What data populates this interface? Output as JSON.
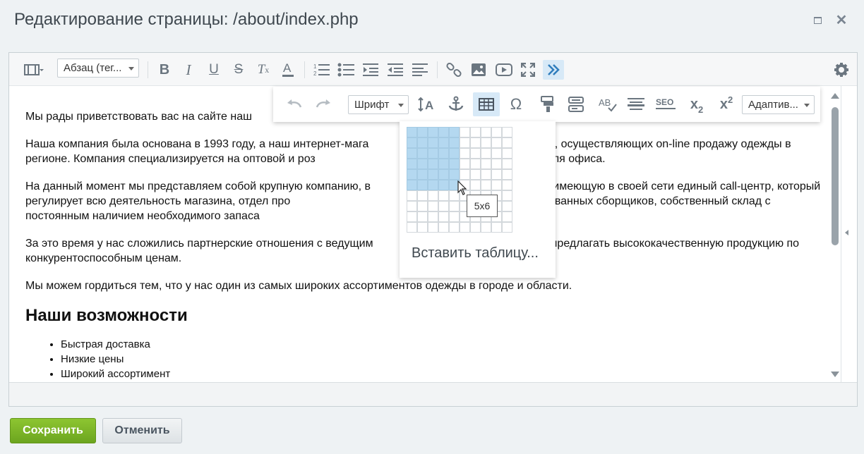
{
  "window": {
    "title": "Редактирование страницы: /about/index.php"
  },
  "toolbar": {
    "paragraph_select": "Абзац (тег...",
    "font_select": "Шрифт",
    "adaptive_select": "Адаптив..."
  },
  "table_picker": {
    "tooltip": "5x6",
    "insert_label": "Вставить таблицу...",
    "selected_cols": 5,
    "selected_rows": 6,
    "grid_cols": 10,
    "grid_rows": 10
  },
  "content": {
    "p1": "Мы рады приветствовать вас на сайте наш",
    "p2": "Наша компания была основана в 1993 году, а наш интернет-мага                                          магазинов, осуществляющих on-line продажу одежды в регионе. Компания специализируется на оптовой и роз                                          ак для дома, так и для офиса.",
    "p3": "На данный момент мы представляем собой крупную компанию, в                                          азином и имеющую в своей сети единый call-центр, который регулирует всю деятельность магазина, отдел про                                          рокий штат квалифицированных сборщиков, собственный склад с постоянным наличием необходимого запаса",
    "p4": "За это время у нас сложились партнерские отношения с ведущим                                          ляющие предлагать высококачественную продукцию по конкурентоспособным ценам.",
    "p5": "Мы можем гордиться тем, что у нас один из самых широких ассортиментов одежды в городе и области.",
    "heading": "Наши возможности",
    "list": [
      "Быстрая доставка",
      "Низкие цены",
      "Широкий ассортимент"
    ]
  },
  "buttons": {
    "save": "Сохранить",
    "cancel": "Отменить"
  },
  "colors": {
    "accent_green": "#7ab527",
    "selection_blue": "#b4d8f0",
    "active_button": "#d7e9f7"
  }
}
